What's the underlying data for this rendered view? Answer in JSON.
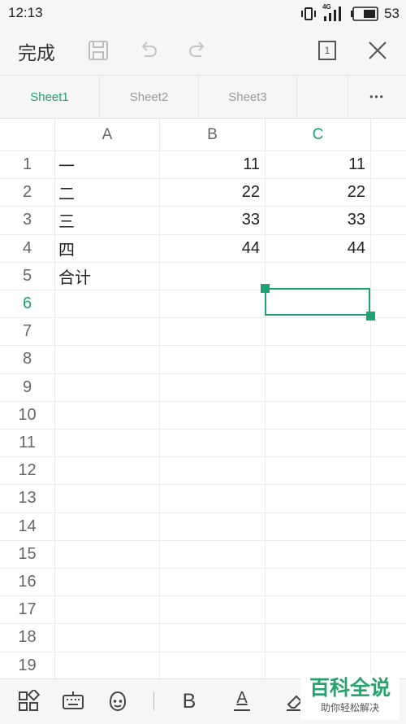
{
  "status_bar": {
    "time": "12:13",
    "network": "4G",
    "battery": "53"
  },
  "toolbar": {
    "done_label": "完成",
    "page_indicator": "1"
  },
  "sheet_tabs": [
    {
      "label": "Sheet1",
      "active": true
    },
    {
      "label": "Sheet2",
      "active": false
    },
    {
      "label": "Sheet3",
      "active": false
    }
  ],
  "more_label": "•••",
  "columns": [
    {
      "label": "A",
      "active": false
    },
    {
      "label": "B",
      "active": false
    },
    {
      "label": "C",
      "active": true
    }
  ],
  "rows": [
    {
      "num": "1",
      "cells": [
        "一",
        "11",
        "11"
      ]
    },
    {
      "num": "2",
      "cells": [
        "二",
        "22",
        "22"
      ]
    },
    {
      "num": "3",
      "cells": [
        "三",
        "33",
        "33"
      ]
    },
    {
      "num": "4",
      "cells": [
        "四",
        "44",
        "44"
      ]
    },
    {
      "num": "5",
      "cells": [
        "合计",
        "",
        ""
      ]
    },
    {
      "num": "6",
      "cells": [
        "",
        "",
        ""
      ]
    },
    {
      "num": "7",
      "cells": [
        "",
        "",
        ""
      ]
    },
    {
      "num": "8",
      "cells": [
        "",
        "",
        ""
      ]
    },
    {
      "num": "9",
      "cells": [
        "",
        "",
        ""
      ]
    },
    {
      "num": "10",
      "cells": [
        "",
        "",
        ""
      ]
    },
    {
      "num": "11",
      "cells": [
        "",
        "",
        ""
      ]
    },
    {
      "num": "12",
      "cells": [
        "",
        "",
        ""
      ]
    },
    {
      "num": "13",
      "cells": [
        "",
        "",
        ""
      ]
    },
    {
      "num": "14",
      "cells": [
        "",
        "",
        ""
      ]
    },
    {
      "num": "15",
      "cells": [
        "",
        "",
        ""
      ]
    },
    {
      "num": "16",
      "cells": [
        "",
        "",
        ""
      ]
    },
    {
      "num": "17",
      "cells": [
        "",
        "",
        ""
      ]
    },
    {
      "num": "18",
      "cells": [
        "",
        "",
        ""
      ]
    },
    {
      "num": "19",
      "cells": [
        "",
        "",
        ""
      ]
    }
  ],
  "active_row": "6",
  "selected_cell": "C6",
  "bottom_bar": {
    "bold_label": "B",
    "font_color_label": "A"
  },
  "watermark": {
    "title": "百科全说",
    "subtitle": "助你轻松解决"
  },
  "colors": {
    "accent": "#1fa176",
    "bar_bg": "#f6f6f6"
  }
}
